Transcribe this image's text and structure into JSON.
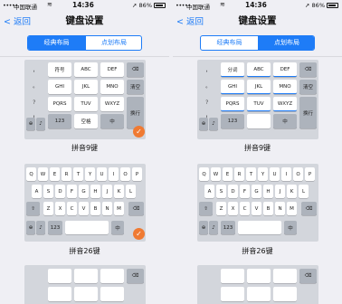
{
  "status": {
    "signal": "•••••",
    "carrier": "中国联通",
    "time": "14:36",
    "battery": "86%"
  },
  "nav": {
    "back": "返回",
    "title": "键盘设置"
  },
  "tabs": [
    "经典布局",
    "点划布局"
  ],
  "layouts": {
    "pinyin9": "拼音9键",
    "pinyin26": "拼音26键"
  },
  "t9": {
    "left_col": [
      "，",
      "。",
      "？",
      "！"
    ],
    "symbol": "符号",
    "abc": "ABC",
    "def": "DEF",
    "ghi": "GHI",
    "jkl": "JKL",
    "mno": "MNO",
    "pqrs": "PQRS",
    "tuv": "TUV",
    "wxyz": "WXYZ",
    "num": "123",
    "space": "空格",
    "cn": "中",
    "clear": "清空",
    "enter": "换行",
    "fenci": "分词"
  },
  "qwerty": {
    "row1": [
      "Q",
      "W",
      "E",
      "R",
      "T",
      "Y",
      "U",
      "I",
      "O",
      "P"
    ],
    "row2": [
      "A",
      "S",
      "D",
      "F",
      "G",
      "H",
      "J",
      "K",
      "L"
    ],
    "row3": [
      "Z",
      "X",
      "C",
      "V",
      "B",
      "N",
      "M"
    ],
    "num": "123",
    "cn": "中"
  },
  "icons": {
    "globe": "globe-icon",
    "mic": "mic-icon",
    "backspace": "backspace-icon",
    "check": "check-icon",
    "shift": "shift-icon"
  },
  "colors": {
    "accent": "#1e7cf7",
    "check": "#f07a32",
    "keyboard_bg": "#d3d6dc",
    "key": "#ffffff"
  }
}
